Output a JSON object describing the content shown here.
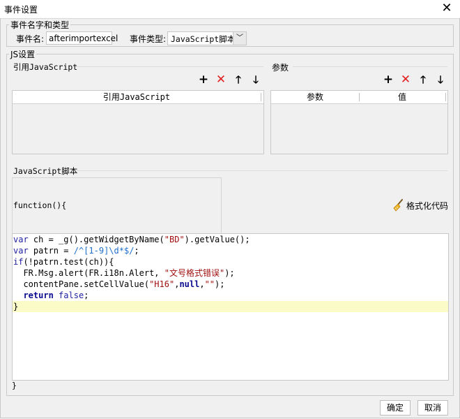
{
  "window": {
    "title": "事件设置"
  },
  "event_group": {
    "legend": "事件名字和类型",
    "name_label": "事件名:",
    "name_value": "afterimportexcel",
    "type_label": "事件类型:",
    "type_value": "JavaScript脚本"
  },
  "js_group": {
    "legend": "JS设置",
    "ref_js": {
      "label": "引用JavaScript",
      "column": "引用JavaScript"
    },
    "params": {
      "label": "参数",
      "columns": [
        "参数",
        "值"
      ]
    },
    "script": {
      "label": "JavaScript脚本",
      "signature": "function(){",
      "format_label": "格式化代码",
      "closing": "}",
      "code_lines": [
        [
          [
            "var",
            "kw"
          ],
          [
            " ch = _g().getWidgetByName(",
            ""
          ],
          [
            "\"BD\"",
            "str"
          ],
          [
            ").getValue();",
            ""
          ]
        ],
        [
          [
            "var",
            "kw"
          ],
          [
            " patrn = ",
            ""
          ],
          [
            "/^[1-9]\\d*$/",
            "rgx"
          ],
          [
            ";",
            ""
          ]
        ],
        [
          [
            "if",
            "kw"
          ],
          [
            "(!patrn.test(ch)){",
            ""
          ]
        ],
        [
          [
            "  FR.Msg.alert(FR.i18n.Alert, ",
            ""
          ],
          [
            "\"文号格式错误\"",
            "str"
          ],
          [
            ");",
            ""
          ]
        ],
        [
          [
            "  contentPane.setCellValue(",
            ""
          ],
          [
            "\"H16\"",
            "str"
          ],
          [
            ",",
            ""
          ],
          [
            "null",
            "kwb"
          ],
          [
            ",",
            ""
          ],
          [
            "\"\"",
            "str"
          ],
          [
            ");",
            ""
          ]
        ],
        [
          [
            "  ",
            ""
          ],
          [
            "return",
            "kwb"
          ],
          [
            " ",
            ""
          ],
          [
            "false",
            "kw"
          ],
          [
            ";",
            ""
          ]
        ],
        [
          [
            "}",
            ""
          ]
        ]
      ]
    }
  },
  "toolbar_icons": {
    "add": "+",
    "delete": "✕",
    "up": "🡑",
    "down": "🡓"
  },
  "buttons": {
    "ok": "确定",
    "cancel": "取消"
  },
  "colors": {
    "delete_red": "#e02020",
    "highlight": "#fbfbc8"
  }
}
